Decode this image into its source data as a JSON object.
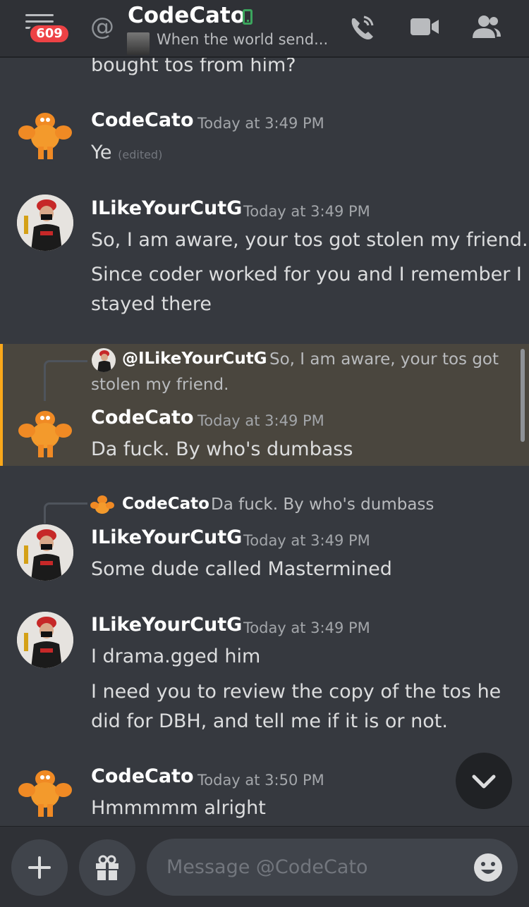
{
  "header": {
    "unread_badge": "609",
    "at_symbol": "@",
    "channel_name": "CodeCato",
    "status_text": "When the world send..."
  },
  "messages": {
    "top_fragment": "bought tos from him?",
    "m1": {
      "author": "CodeCato",
      "time": "Today at 3:49 PM",
      "text": "Ye",
      "edited": "(edited)"
    },
    "m2": {
      "author": "ILikeYourCutG",
      "time": "Today at 3:49 PM",
      "line1": "So, I am aware, your tos got stolen my friend.",
      "line2": "Since coder worked for you and I remember I",
      "line3": "stayed there"
    },
    "m3": {
      "reply_name": "@ILikeYourCutG",
      "reply_text_1": "So, I am aware, your tos got",
      "reply_text_2": "stolen my friend.",
      "author": "CodeCato",
      "time": "Today at 3:49 PM",
      "text": "Da fuck. By who's dumbass"
    },
    "m4": {
      "reply_name": "CodeCato",
      "reply_text": "Da fuck. By who's dumbass",
      "author": "ILikeYourCutG",
      "time": "Today at 3:49 PM",
      "text": "Some dude called Mastermined"
    },
    "m5": {
      "author": "ILikeYourCutG",
      "time": "Today at 3:49 PM",
      "line1": "I drama.gged him",
      "line2": "I need you to review the copy of the tos he",
      "line3": "did for DBH, and tell me if it is or not."
    },
    "m6": {
      "author": "CodeCato",
      "time": "Today at 3:50 PM",
      "text": "Hmmmmm alright"
    }
  },
  "composer": {
    "placeholder": "Message @CodeCato"
  },
  "icons": [
    "menu-icon",
    "at-icon",
    "mobile-status-icon",
    "call-icon",
    "video-icon",
    "members-icon",
    "chevron-down-icon",
    "plus-icon",
    "gift-icon",
    "emoji-icon"
  ],
  "colors": {
    "accent_badge": "#ed4245",
    "highlight": "#4a463e",
    "highlight_bar": "#faa81a",
    "online": "#3ba55d"
  }
}
